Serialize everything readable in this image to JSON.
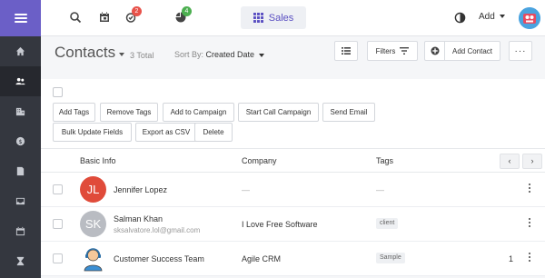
{
  "topbar": {
    "reminders_badge": "2",
    "activity_badge": "4",
    "module_label": "Sales",
    "add_label": "Add"
  },
  "page": {
    "title": "Contacts",
    "total": "3 Total",
    "sort_label": "Sort By:",
    "sort_value": "Created Date",
    "filters_label": "Filters",
    "add_contact_label": "Add Contact"
  },
  "actions": [
    "Add Tags",
    "Remove Tags",
    "Add to Campaign",
    "Start Call Campaign",
    "Send Email",
    "Bulk Update Fields",
    "Export as CSV",
    "Delete"
  ],
  "table": {
    "columns": [
      "Basic Info",
      "Company",
      "Tags"
    ],
    "rows": [
      {
        "initials": "JL",
        "avatar_color": "#e04b3a",
        "name": "Jennifer Lopez",
        "email": "",
        "company": "—",
        "tag": "—",
        "count": ""
      },
      {
        "initials": "SK",
        "avatar_color": "#b9bcc2",
        "name": "Salman Khan",
        "email": "sksalvatore.lol@gmail.com",
        "company": "I Love Free Software",
        "tag": "client",
        "count": ""
      },
      {
        "initials": "",
        "avatar_color": "#ffffff",
        "name": "Customer Success Team",
        "email": "",
        "company": "Agile CRM",
        "tag": "Sample",
        "count": "1"
      }
    ]
  },
  "colors": {
    "brand": "#6b5fc7",
    "sidebar": "#34373f",
    "accent": "#5a4fc2"
  },
  "icons": {
    "sidebar": [
      "home-icon",
      "contacts-icon",
      "companies-icon",
      "deals-icon",
      "documents-icon",
      "inbox-icon",
      "calendar-icon",
      "hourglass-icon"
    ],
    "topbar": [
      "search-icon",
      "calendar-icon",
      "reminders-icon",
      "activity-icon",
      "theme-icon"
    ]
  }
}
